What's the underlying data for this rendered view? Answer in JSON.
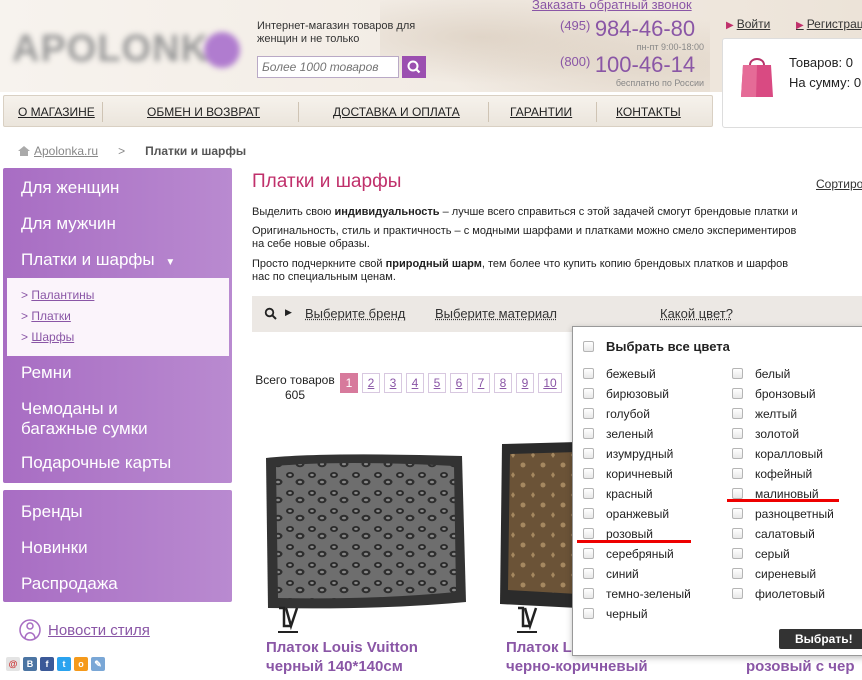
{
  "header": {
    "logo_text": "APOLONKA",
    "tagline": "Интернет-магазин товаров для женщин и не только",
    "search_placeholder": "Более 1000 товаров",
    "callback": "Заказать обратный звонок",
    "phone1_code": "(495)",
    "phone1_number": "984-46-80",
    "phone1_hours": "пн-пт 9:00-18:00",
    "phone2_code": "(800)",
    "phone2_number": "100-46-14",
    "phone2_hours": "бесплатно по России",
    "login": "Войти",
    "register": "Регистрация",
    "cart_items": "Товаров: 0",
    "cart_sum": "На сумму: 0"
  },
  "topnav": [
    "О МАГАЗИНЕ",
    "ОБМЕН И ВОЗВРАТ",
    "ДОСТАВКА И ОПЛАТА",
    "ГАРАНТИИ",
    "КОНТАКТЫ"
  ],
  "breadcrumb": {
    "home": "Apolonka.ru",
    "sep": ">",
    "current": "Платки и шарфы"
  },
  "sidebar": {
    "items": [
      "Для женщин",
      "Для мужчин",
      "Платки и шарфы"
    ],
    "subitems": [
      "Палантины",
      "Платки",
      "Шарфы"
    ],
    "items_after": [
      "Ремни",
      "Чемоданы и багажные сумки",
      "Подарочные карты"
    ],
    "items2": [
      "Бренды",
      "Новинки",
      "Распродажа"
    ],
    "news": "Новости стиля"
  },
  "content": {
    "title": "Платки и шарфы",
    "sort": "Сортировать",
    "p1_pre": "Выделить свою ",
    "p1_bold": "индивидуальность",
    "p1_post": " – лучше всего справиться с этой задачей смогут брендовые платки и",
    "p2_line1": "Оригинальность, стиль и практичность – с модными шарфами и платками можно смело экспериментиров",
    "p2_line2": "на себе новые образы.",
    "p3_pre": "Просто подчеркните свой ",
    "p3_bold": "природный шарм",
    "p3_post": ", тем более что купить копию брендовых платков и шарфов",
    "p3_line2": "нас по специальным ценам.",
    "filter_brand": "Выберите бренд",
    "filter_material": "Выберите материал",
    "filter_color": "Какой цвет?",
    "total_label": "Всего товаров",
    "total_count": "605",
    "pages": [
      "1",
      "2",
      "3",
      "4",
      "5",
      "6",
      "7",
      "8",
      "9",
      "10"
    ]
  },
  "products": [
    {
      "name_line1": "Платок Louis Vuitton",
      "name_line2": "черный 140*140см"
    },
    {
      "name_line1": "Платок L",
      "name_line2": "черно-коричневый"
    },
    {
      "name_line1": "",
      "name_line2": "розовый с чер"
    }
  ],
  "colors": {
    "select_all": "Выбрать все цвета",
    "col1": [
      "бежевый",
      "бирюзовый",
      "голубой",
      "зеленый",
      "изумрудный",
      "коричневый",
      "красный",
      "оранжевый",
      "розовый",
      "серебряный",
      "синий",
      "темно-зеленый",
      "черный"
    ],
    "col2": [
      "белый",
      "бронзовый",
      "желтый",
      "золотой",
      "коралловый",
      "кофейный",
      "малиновый",
      "разноцветный",
      "салатовый",
      "серый",
      "сиреневый",
      "фиолетовый"
    ],
    "button": "Выбрать!"
  },
  "theme": {
    "accent": "#8a56a6",
    "sidebar": "#a86dc3",
    "title": "#c0306b"
  }
}
